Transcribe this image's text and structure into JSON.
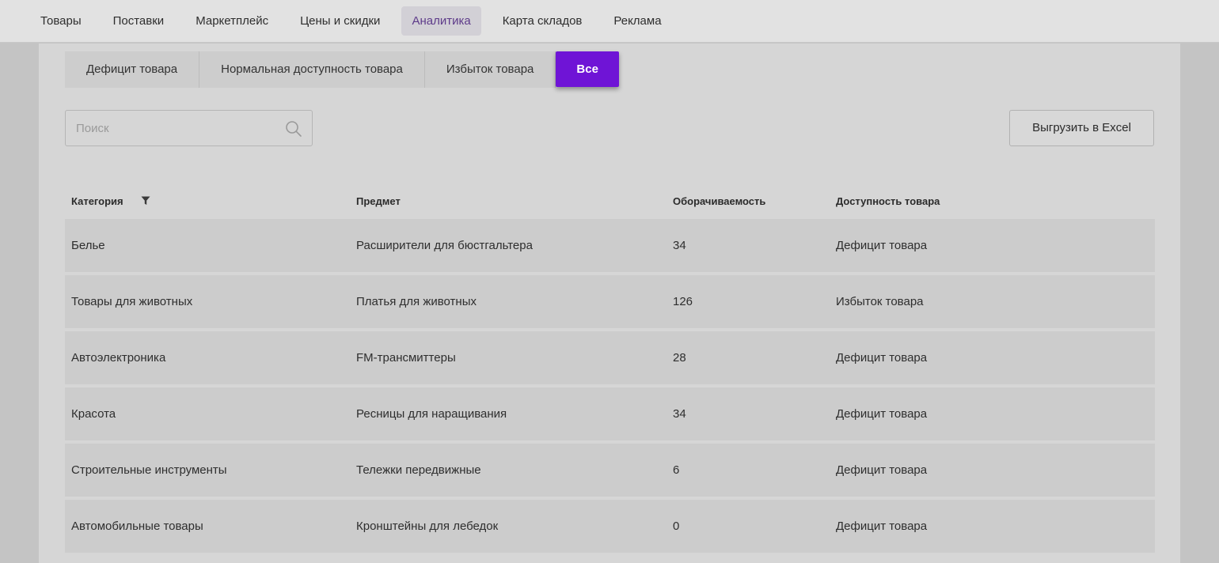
{
  "nav": {
    "items": [
      {
        "label": "Товары"
      },
      {
        "label": "Поставки"
      },
      {
        "label": "Маркетплейс"
      },
      {
        "label": "Цены и скидки"
      },
      {
        "label": "Аналитика",
        "active": true
      },
      {
        "label": "Карта складов"
      },
      {
        "label": "Реклама"
      }
    ]
  },
  "filters": {
    "tabs": [
      {
        "label": "Дефицит товара"
      },
      {
        "label": "Нормальная доступность товара"
      },
      {
        "label": "Избыток товара"
      },
      {
        "label": "Все",
        "active": true
      }
    ]
  },
  "search": {
    "placeholder": "Поиск",
    "value": ""
  },
  "export": {
    "label": "Выгрузить в Excel"
  },
  "table": {
    "headers": {
      "category": "Категория",
      "subject": "Предмет",
      "turnover": "Оборачиваемость",
      "availability": "Доступность товара"
    },
    "rows": [
      {
        "category": "Белье",
        "subject": "Расширители для бюстгальтера",
        "turnover": "34",
        "availability": "Дефицит товара"
      },
      {
        "category": "Товары для животных",
        "subject": "Платья для животных",
        "turnover": "126",
        "availability": "Избыток товара"
      },
      {
        "category": "Автоэлектроника",
        "subject": "FM-трансмиттеры",
        "turnover": "28",
        "availability": "Дефицит товара"
      },
      {
        "category": "Красота",
        "subject": "Ресницы для наращивания",
        "turnover": "34",
        "availability": "Дефицит товара"
      },
      {
        "category": "Строительные инструменты",
        "subject": "Тележки передвижные",
        "turnover": "6",
        "availability": "Дефицит товара"
      },
      {
        "category": "Автомобильные товары",
        "subject": "Кронштейны для лебедок",
        "turnover": "0",
        "availability": "Дефицит товара"
      }
    ]
  },
  "colors": {
    "accent": "#6f14d6",
    "active_nav_text": "#5e3b8a"
  }
}
